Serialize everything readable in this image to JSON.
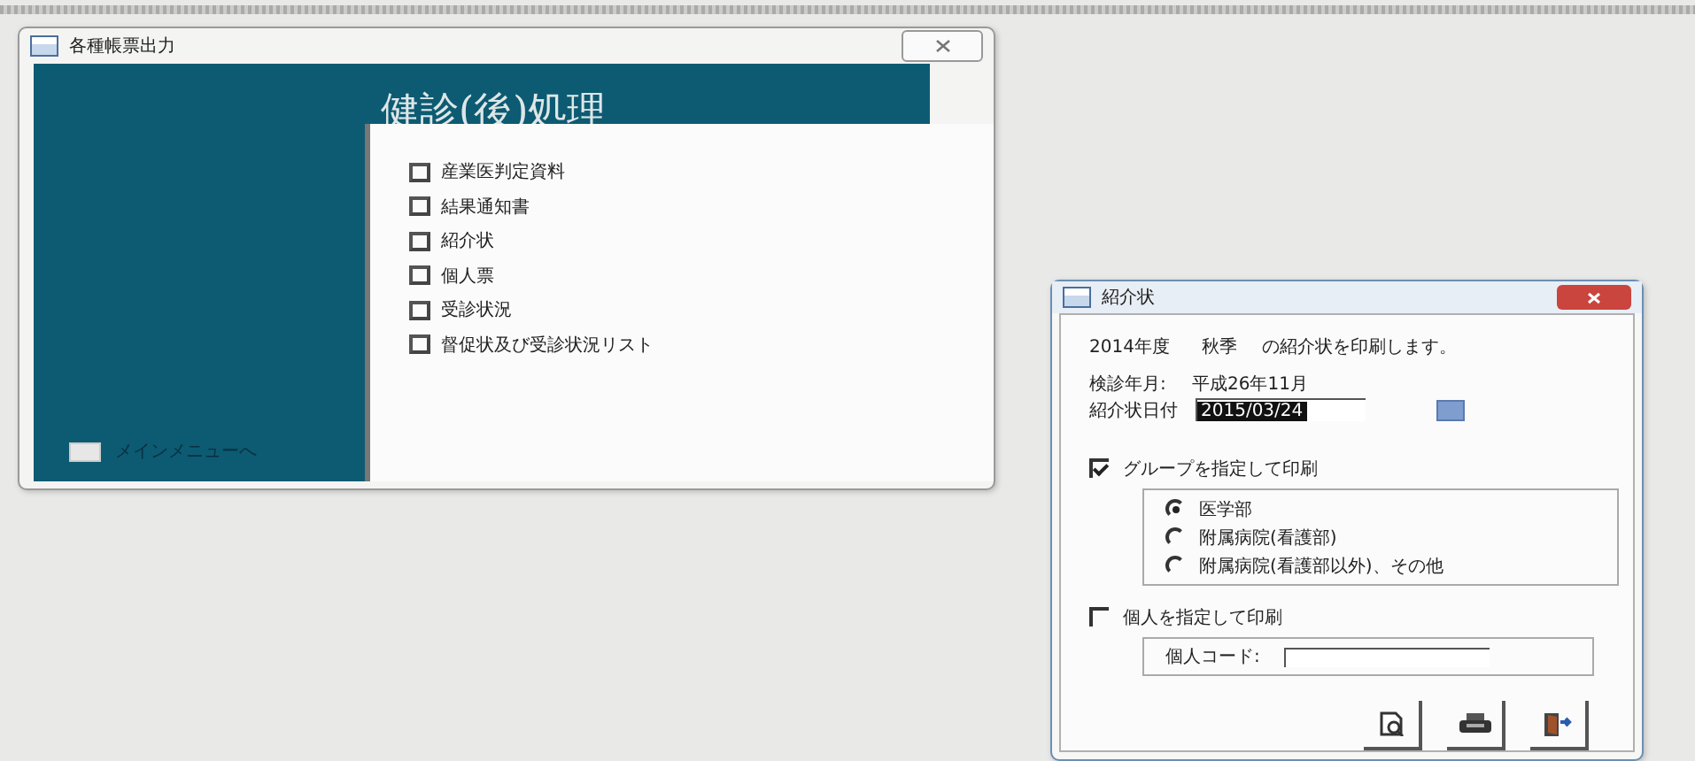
{
  "report_window": {
    "title": "各種帳票出力",
    "heading": "健診(後)処理",
    "items": [
      {
        "label": "産業医判定資料"
      },
      {
        "label": "結果通知書"
      },
      {
        "label": "紹介状"
      },
      {
        "label": "個人票"
      },
      {
        "label": "受診状況"
      },
      {
        "label": "督促状及び受診状況リスト"
      }
    ],
    "main_menu_label": "メインメニューへ"
  },
  "letter_window": {
    "title": "紹介状",
    "year": "2014年度",
    "season": "秋季",
    "message": "の紹介状を印刷します。",
    "exam_month_label": "検診年月:",
    "exam_month": "平成26年11月",
    "date_label": "紹介状日付",
    "date_value": "2015/03/24",
    "group_option": {
      "label": "グループを指定して印刷",
      "checked": true
    },
    "groups": [
      {
        "label": "医学部",
        "selected": true
      },
      {
        "label": "附属病院(看護部)",
        "selected": false
      },
      {
        "label": "附属病院(看護部以外)、その他",
        "selected": false
      }
    ],
    "person_option": {
      "label": "個人を指定して印刷",
      "checked": false
    },
    "person_code_label": "個人コード:"
  }
}
